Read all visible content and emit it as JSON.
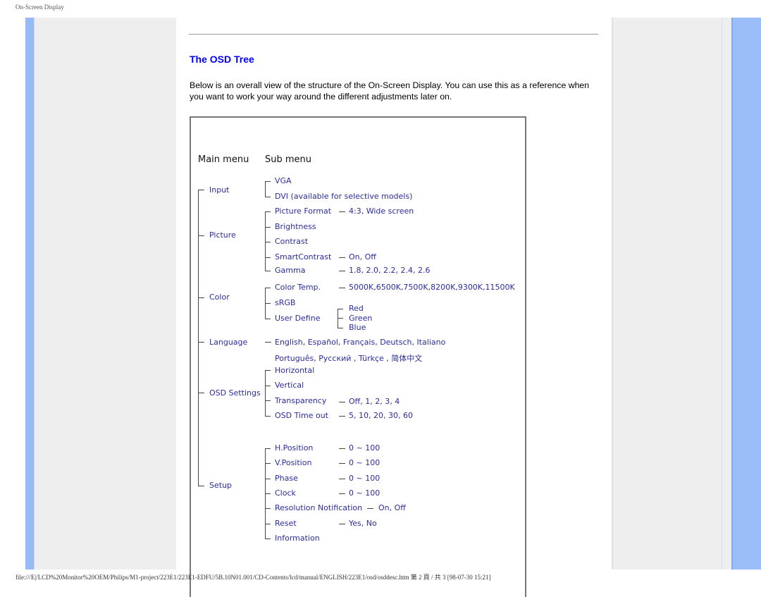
{
  "page": {
    "top_label": "On-Screen Display",
    "title": "The OSD Tree",
    "intro": "Below is an overall view of the structure of the On-Screen Display. You can use this as a reference when you want to work your way around the different adjustments later on.",
    "footer": "file:///E|/LCD%20Monitor%20OEM/Philips/M1-project/223E1/223E1-EDFU/5B.10N01.001/CD-Contents/lcd/manual/ENGLISH/223E1/osd/osddesc.htm 第 2 頁 / 共 3 [98-07-30 15:21]"
  },
  "colors": {
    "title": "#0000ff",
    "tree_text": "#2b2b9e",
    "side_bar": "#99bbf5",
    "panel": "#eeeeee"
  },
  "tree": {
    "headers": {
      "main": "Main menu",
      "sub": "Sub menu"
    },
    "input": {
      "label": "Input",
      "items": [
        "VGA",
        "DVI (available for selective models)"
      ]
    },
    "picture": {
      "label": "Picture",
      "items": [
        {
          "label": "Picture Format",
          "value": "4:3, Wide screen"
        },
        {
          "label": "Brightness",
          "value": ""
        },
        {
          "label": "Contrast",
          "value": ""
        },
        {
          "label": "SmartContrast",
          "value": "On, Off"
        },
        {
          "label": "Gamma",
          "value": "1.8, 2.0, 2.2, 2.4, 2.6"
        }
      ]
    },
    "color": {
      "label": "Color",
      "items": [
        {
          "label": "Color Temp.",
          "value": "5000K,6500K,7500K,8200K,9300K,11500K"
        },
        {
          "label": "sRGB",
          "value": ""
        },
        {
          "label": "User Define",
          "value": ""
        }
      ],
      "user_define": [
        "Red",
        "Green",
        "Blue"
      ]
    },
    "language": {
      "label": "Language",
      "line1": "English, Español, Français, Deutsch, Italiano",
      "line2": "Português, Русский , Türkçe , 简体中文"
    },
    "osd": {
      "label": "OSD Settings",
      "items": [
        {
          "label": "Horizontal",
          "value": ""
        },
        {
          "label": "Vertical",
          "value": ""
        },
        {
          "label": "Transparency",
          "value": "Off, 1, 2, 3, 4"
        },
        {
          "label": "OSD Time out",
          "value": "5, 10, 20, 30, 60"
        }
      ]
    },
    "setup": {
      "label": "Setup",
      "items": [
        {
          "label": "H.Position",
          "value": "0 ~ 100"
        },
        {
          "label": "V.Position",
          "value": "0 ~ 100"
        },
        {
          "label": "Phase",
          "value": "0 ~ 100"
        },
        {
          "label": "Clock",
          "value": "0 ~ 100"
        },
        {
          "label": "Resolution Notification",
          "value": "On, Off"
        },
        {
          "label": "Reset",
          "value": "Yes, No"
        },
        {
          "label": "Information",
          "value": ""
        }
      ]
    }
  }
}
